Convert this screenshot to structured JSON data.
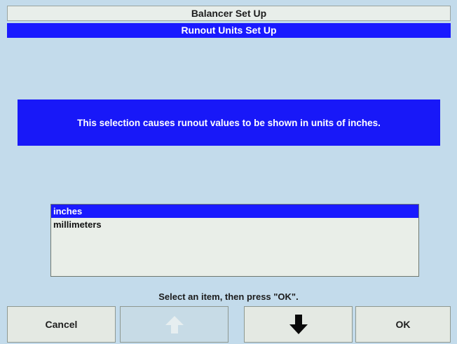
{
  "window": {
    "title": "Balancer Set Up",
    "subtitle": "Runout Units Set Up"
  },
  "info": {
    "message": "This selection causes runout values to be shown in units of inches."
  },
  "list": {
    "items": [
      {
        "label": "inches",
        "selected": true
      },
      {
        "label": "millimeters",
        "selected": false
      }
    ]
  },
  "instruction": "Select an item, then press \"OK\".",
  "buttons": {
    "cancel_label": "Cancel",
    "up_icon": "arrow-up-icon",
    "down_icon": "arrow-down-icon",
    "ok_label": "OK"
  },
  "colors": {
    "accent": "#1a1aff",
    "background": "#c3dbeb"
  }
}
